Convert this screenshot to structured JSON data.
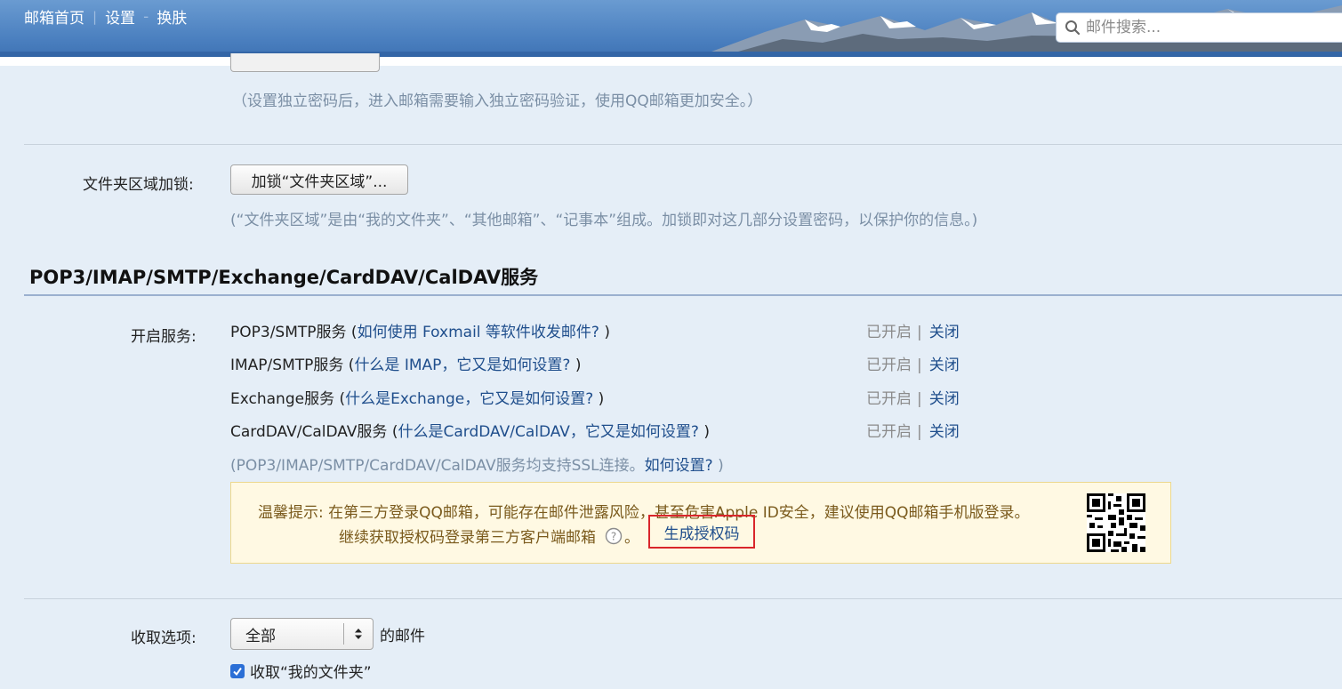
{
  "header": {
    "links": [
      "邮箱首页",
      "设置",
      "换肤"
    ],
    "search_placeholder": "邮件搜索..."
  },
  "password_section": {
    "hint": "（设置独立密码后，进入邮箱需要输入独立密码验证，使用QQ邮箱更加安全。）"
  },
  "folder_lock": {
    "label": "文件夹区域加锁:",
    "button": "加锁“文件夹区域”...",
    "hint": "(“文件夹区域”是由“我的文件夹”、“其他邮箱”、“记事本”组成。加锁即对这几部分设置密码，以保护你的信息。)"
  },
  "services_section": {
    "title": "POP3/IMAP/SMTP/Exchange/CardDAV/CalDAV服务",
    "label": "开启服务:",
    "rows": [
      {
        "name": "POP3/SMTP服务",
        "help_prefix": " (",
        "help": "如何使用 Foxmail 等软件收发邮件?",
        "help_suffix": " )",
        "status": "已开启",
        "sep": "|",
        "action": "关闭"
      },
      {
        "name": "IMAP/SMTP服务",
        "help_prefix": " (",
        "help": "什么是 IMAP，它又是如何设置?",
        "help_suffix": " )",
        "status": "已开启",
        "sep": "|",
        "action": "关闭"
      },
      {
        "name": "Exchange服务",
        "help_prefix": " (",
        "help": "什么是Exchange，它又是如何设置?",
        "help_suffix": " )",
        "status": "已开启",
        "sep": "|",
        "action": "关闭"
      },
      {
        "name": "CardDAV/CalDAV服务",
        "help_prefix": " (",
        "help": "什么是CardDAV/CalDAV，它又是如何设置?",
        "help_suffix": " )",
        "status": "已开启",
        "sep": "|",
        "action": "关闭"
      }
    ],
    "ssl_note": "(POP3/IMAP/SMTP/CardDAV/CalDAV服务均支持SSL连接。",
    "ssl_link": "如何设置?",
    "ssl_end": " )"
  },
  "tip": {
    "line1": "温馨提示:  在第三方登录QQ邮箱，可能存在邮件泄露风险，甚至危害Apple ID安全，建议使用QQ邮箱手机版登录。",
    "line2": "继续获取授权码登录第三方客户端邮箱",
    "line2_end": "。",
    "generate_link": "生成授权码"
  },
  "receive": {
    "label": "收取选项:",
    "select_value": "全部",
    "after_select": "的邮件",
    "checkbox_label": "收取“我的文件夹”",
    "checkbox_checked": true
  }
}
